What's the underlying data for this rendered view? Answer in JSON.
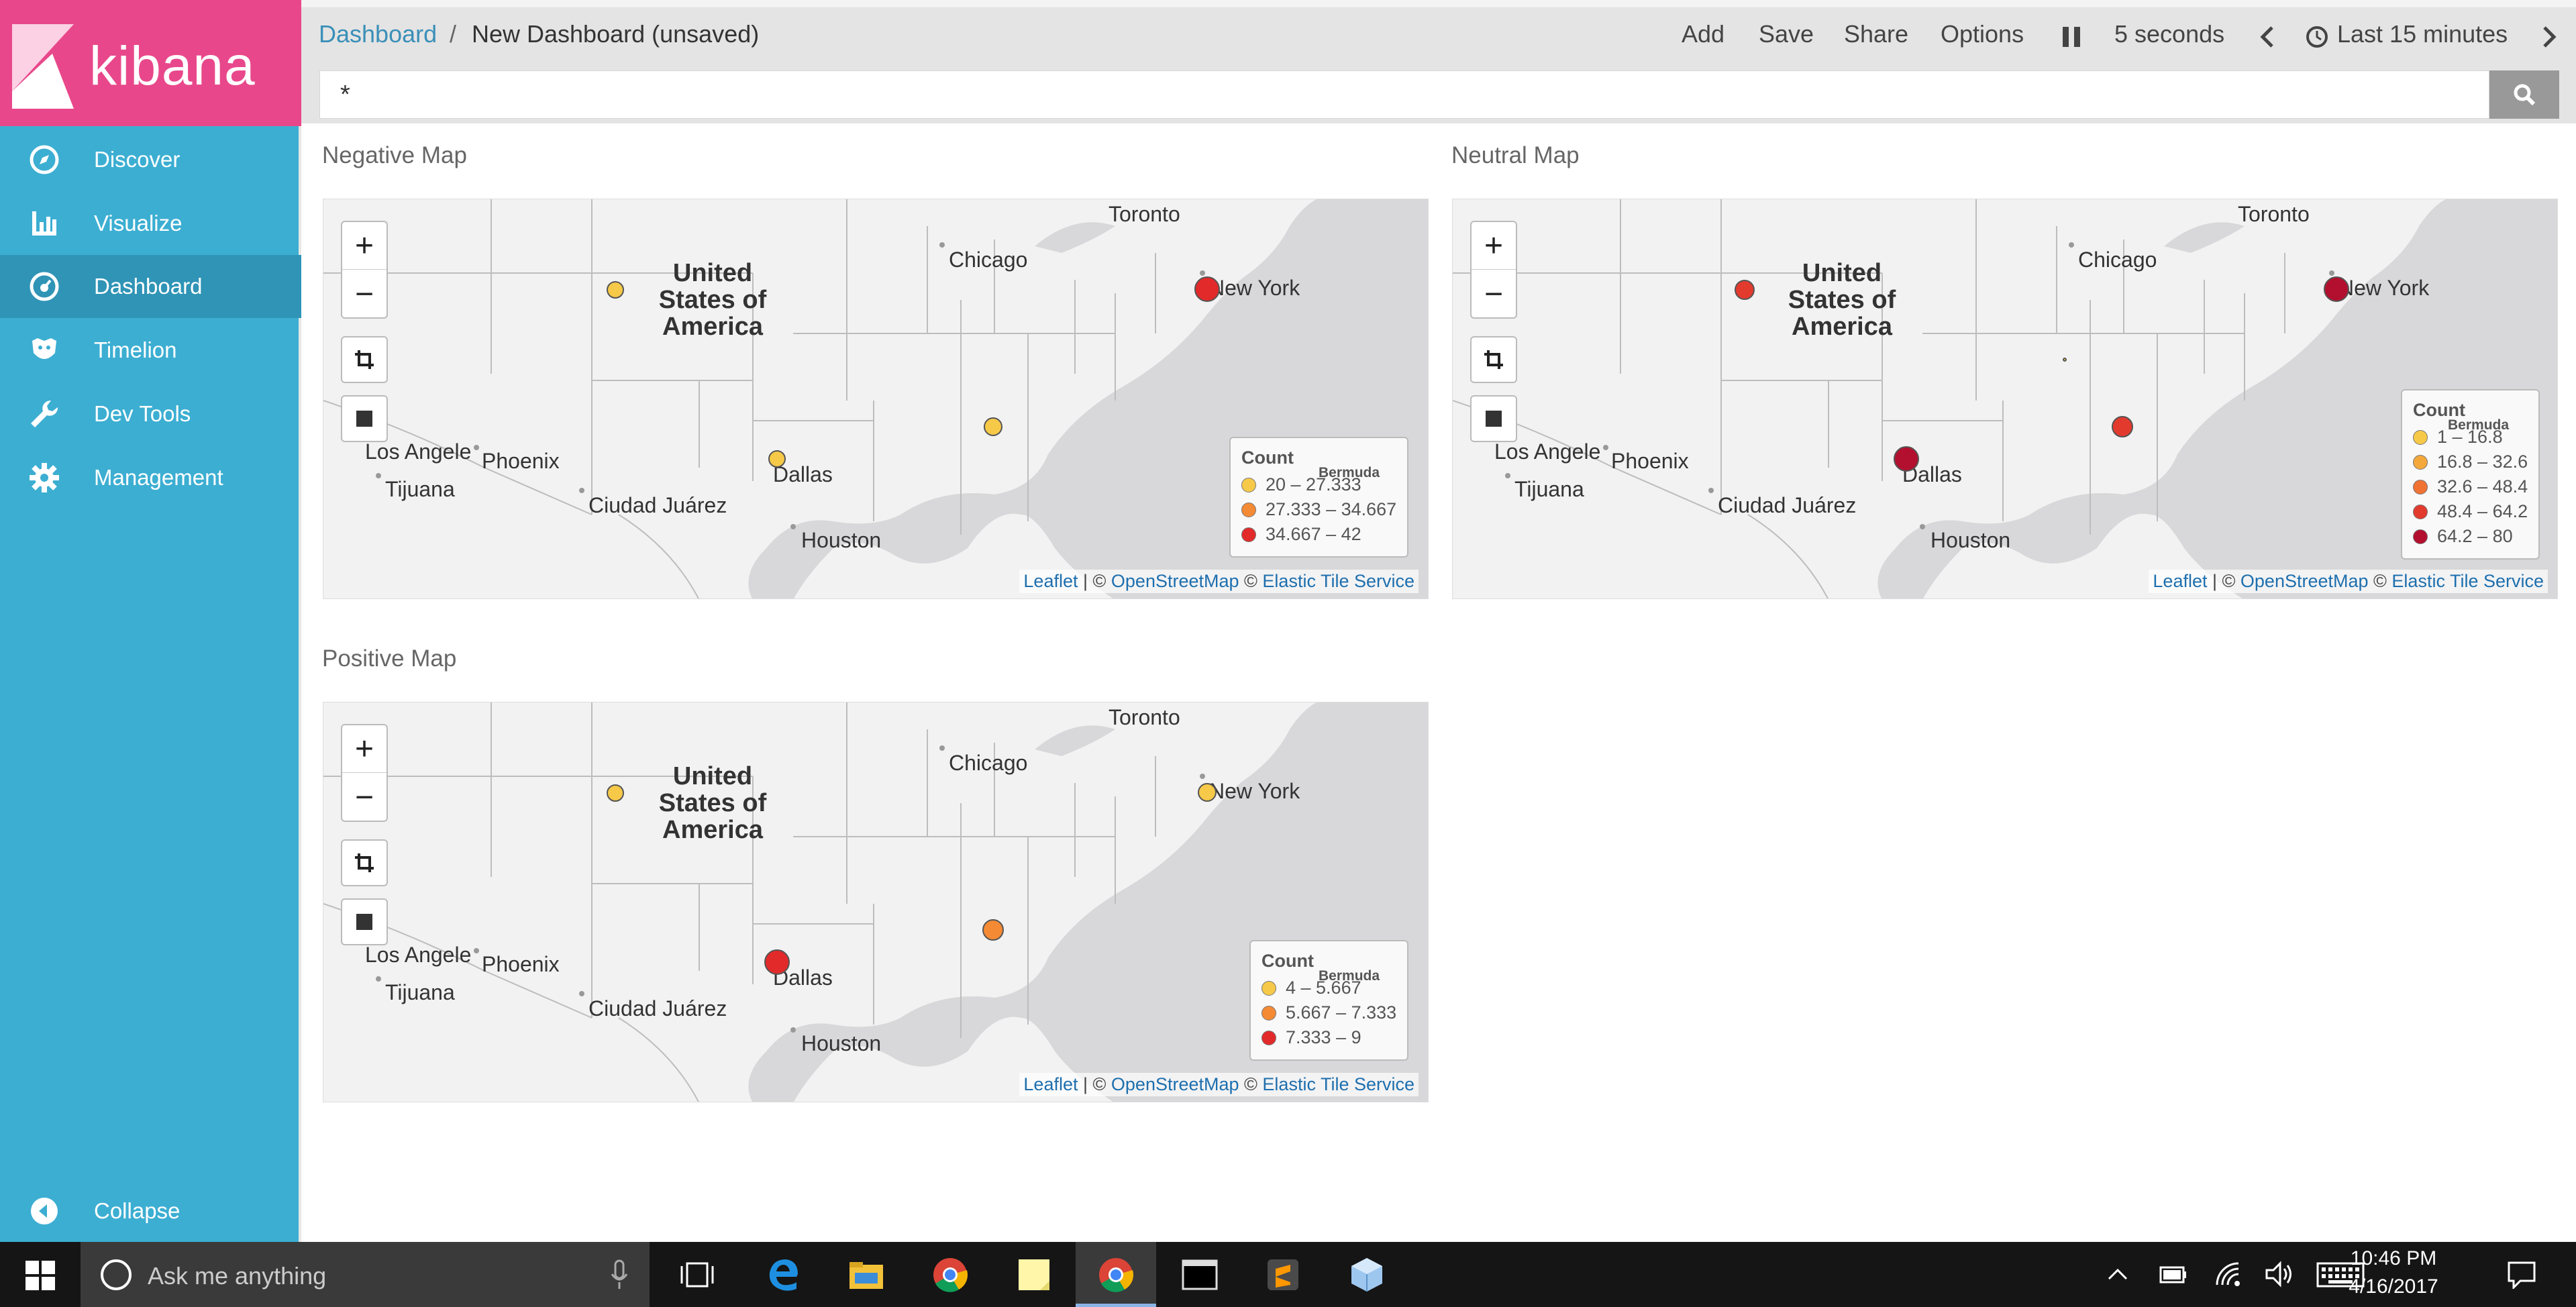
{
  "app": {
    "logo_text": "kibana"
  },
  "sidebar": {
    "items": [
      {
        "label": "Discover",
        "icon": "compass-icon"
      },
      {
        "label": "Visualize",
        "icon": "bar-chart-icon"
      },
      {
        "label": "Dashboard",
        "icon": "dashboard-icon",
        "active": true
      },
      {
        "label": "Timelion",
        "icon": "timelion-icon"
      },
      {
        "label": "Dev Tools",
        "icon": "wrench-icon"
      },
      {
        "label": "Management",
        "icon": "gear-icon"
      }
    ],
    "collapse_label": "Collapse"
  },
  "header": {
    "breadcrumb_link": "Dashboard",
    "breadcrumb_sep": "/",
    "breadcrumb_current": "New Dashboard (unsaved)",
    "add": "Add",
    "save": "Save",
    "share": "Share",
    "options": "Options",
    "refresh_interval": "5 seconds",
    "time_range": "Last 15 minutes"
  },
  "query": {
    "value": "*"
  },
  "panels": {
    "negative": {
      "title": "Negative Map",
      "legend_title": "Count",
      "legend": [
        {
          "label": "20 – 27.333",
          "color": "#f7c948"
        },
        {
          "label": "27.333 – 34.667",
          "color": "#f58a35"
        },
        {
          "label": "34.667 – 42",
          "color": "#e22a2a"
        }
      ]
    },
    "neutral": {
      "title": "Neutral Map",
      "legend_title": "Count",
      "legend": [
        {
          "label": "1 – 16.8",
          "color": "#f7c948"
        },
        {
          "label": "16.8 – 32.6",
          "color": "#f5a83a"
        },
        {
          "label": "32.6 – 48.4",
          "color": "#f17333"
        },
        {
          "label": "48.4 – 64.2",
          "color": "#e33a2e"
        },
        {
          "label": "64.2 – 80",
          "color": "#b3102f"
        }
      ]
    },
    "positive": {
      "title": "Positive Map",
      "legend_title": "Count",
      "legend": [
        {
          "label": "4 – 5.667",
          "color": "#f7c948"
        },
        {
          "label": "5.667 – 7.333",
          "color": "#f58a35"
        },
        {
          "label": "7.333 – 9",
          "color": "#e22a2a"
        }
      ]
    }
  },
  "map_labels": {
    "country_l1": "United",
    "country_l2": "States of",
    "country_l3": "America",
    "toronto": "Toronto",
    "chicago": "Chicago",
    "new_york": "New York",
    "los_angeles": "Los Angele",
    "phoenix": "Phoenix",
    "tijuana": "Tijuana",
    "ciudad_juarez": "Ciudad Juárez",
    "dallas": "Dallas",
    "houston": "Houston",
    "bermuda": "Bermuda"
  },
  "attribution": {
    "leaflet": "Leaflet",
    "sep": " | © ",
    "osm": "OpenStreetMap",
    "copy": " © ",
    "ets": "Elastic Tile Service"
  },
  "taskbar": {
    "search_placeholder": "Ask me anything",
    "time": "10:46 PM",
    "date": "4/16/2017"
  }
}
